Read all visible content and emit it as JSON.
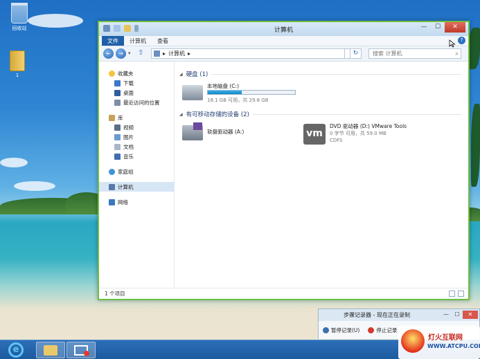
{
  "desktop": {
    "icons": [
      {
        "label": "回收站"
      },
      {
        "label": "1"
      }
    ]
  },
  "explorer": {
    "title": "计算机",
    "ribbon_tabs": [
      "文件",
      "计算机",
      "查看"
    ],
    "address_path": "计算机",
    "search_placeholder": "搜索 计算机",
    "nav": {
      "favorites": "收藏夹",
      "favorites_items": [
        "下载",
        "桌面",
        "最近访问的位置"
      ],
      "libraries": "库",
      "libraries_items": [
        "视频",
        "图片",
        "文档",
        "音乐"
      ],
      "homegroup": "家庭组",
      "computer": "计算机",
      "network": "网络"
    },
    "groups": {
      "hard_disks": "硬盘 (1)",
      "removable": "有可移动存储的设备 (2)"
    },
    "drives": {
      "local_c": {
        "name": "本地磁盘 (C:)",
        "free_text": "18.1 GB 可用，共 29.8 GB",
        "used_fraction": 0.39
      },
      "floppy_a": {
        "name": "软盘驱动器 (A:)"
      },
      "dvd_d": {
        "name": "DVD 驱动器 (D:) VMware Tools",
        "free_text": "0 字节 可用，共 59.0 MB",
        "fs": "CDFS"
      }
    },
    "status": "1 个项目"
  },
  "steps_recorder": {
    "title": "步骤记录器 - 现在正在录制",
    "pause": "暂停记录(U)",
    "stop": "停止记录"
  },
  "watermark": {
    "line1": "灯火互联网",
    "line2": "WWW.ATCPU.COM"
  },
  "colors": {
    "window_border": "#6fbf43",
    "file_tab": "#1f5ea8",
    "taskbar": "#1d5aa0",
    "close": "#c0392b"
  }
}
